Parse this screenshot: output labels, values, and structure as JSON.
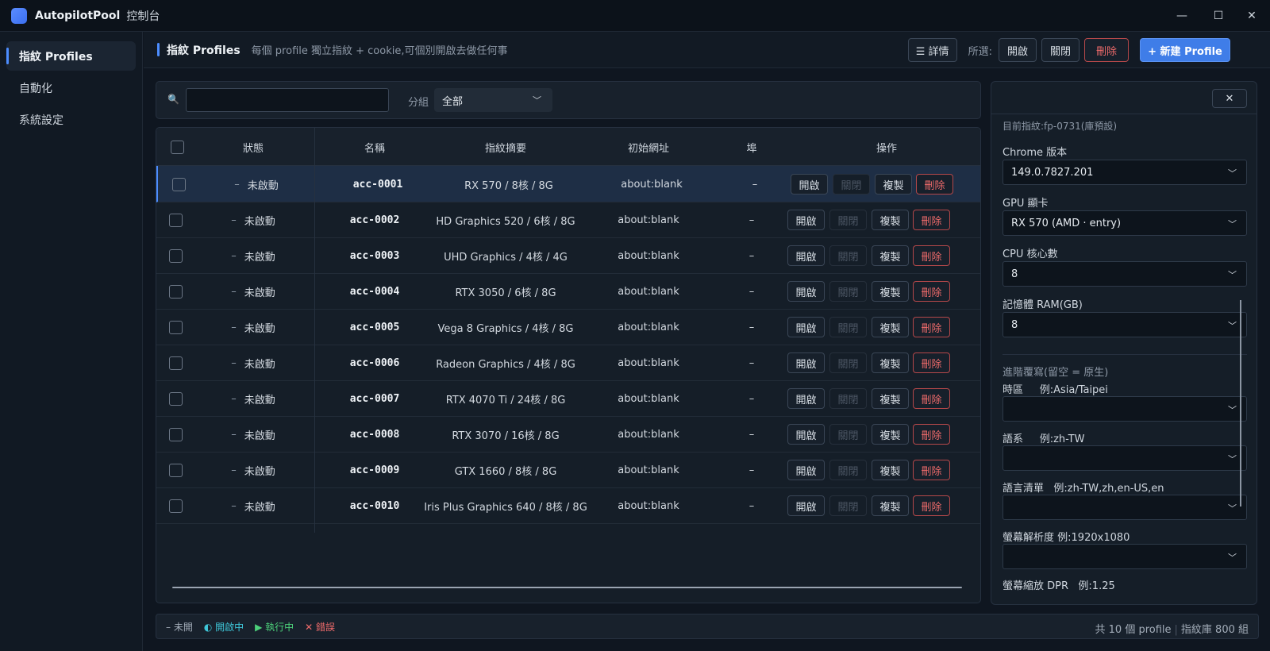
{
  "app": {
    "name": "AutopilotPool",
    "subtitle": "控制台"
  },
  "window_controls": {
    "minimize": "—",
    "maximize": "☐",
    "close": "✕"
  },
  "sidebar": {
    "items": [
      {
        "label": "指紋 Profiles",
        "active": true
      },
      {
        "label": "自動化",
        "active": false
      },
      {
        "label": "系統設定",
        "active": false
      }
    ]
  },
  "header": {
    "title": "指紋 Profiles",
    "description": "每個 profile 獨立指紋 + cookie,可個別開啟去做任何事",
    "details_button": "☰ 詳情",
    "selected_label": "所選:",
    "open_button": "開啟",
    "close_button": "關閉",
    "delete_button": "刪除",
    "new_button": "+ 新建 Profile"
  },
  "filter": {
    "search_icon": "🔍",
    "search_value": "",
    "group_label": "分組",
    "group_value": "全部"
  },
  "table": {
    "columns": [
      "狀態",
      "名稱",
      "指紋摘要",
      "初始網址",
      "埠",
      "操作"
    ],
    "actions": {
      "open": "開啟",
      "close": "關閉",
      "copy": "複製",
      "delete": "刪除"
    },
    "rows": [
      {
        "status": "未啟動",
        "name": "acc-0001",
        "summary": "RX 570 / 8核 / 8G",
        "url": "about:blank",
        "port": "–"
      },
      {
        "status": "未啟動",
        "name": "acc-0002",
        "summary": "HD Graphics 520 / 6核 / 8G",
        "url": "about:blank",
        "port": "–"
      },
      {
        "status": "未啟動",
        "name": "acc-0003",
        "summary": "UHD Graphics / 4核 / 4G",
        "url": "about:blank",
        "port": "–"
      },
      {
        "status": "未啟動",
        "name": "acc-0004",
        "summary": "RTX 3050 / 6核 / 8G",
        "url": "about:blank",
        "port": "–"
      },
      {
        "status": "未啟動",
        "name": "acc-0005",
        "summary": "Vega 8 Graphics / 4核 / 8G",
        "url": "about:blank",
        "port": "–"
      },
      {
        "status": "未啟動",
        "name": "acc-0006",
        "summary": "Radeon Graphics / 4核 / 8G",
        "url": "about:blank",
        "port": "–"
      },
      {
        "status": "未啟動",
        "name": "acc-0007",
        "summary": "RTX 4070 Ti / 24核 / 8G",
        "url": "about:blank",
        "port": "–"
      },
      {
        "status": "未啟動",
        "name": "acc-0008",
        "summary": "RTX 3070 / 16核 / 8G",
        "url": "about:blank",
        "port": "–"
      },
      {
        "status": "未啟動",
        "name": "acc-0009",
        "summary": "GTX 1660 / 8核 / 8G",
        "url": "about:blank",
        "port": "–"
      },
      {
        "status": "未啟動",
        "name": "acc-0010",
        "summary": "Iris Plus Graphics 640 / 8核 / 8G",
        "url": "about:blank",
        "port": "–"
      }
    ]
  },
  "detail": {
    "close_icon": "✕",
    "current_fp": "目前指紋:fp-0731(庫預設)",
    "chrome_label": "Chrome 版本",
    "chrome_value": "149.0.7827.201",
    "gpu_label": "GPU 顯卡",
    "gpu_value": "RX 570  (AMD · entry)",
    "cpu_label": "CPU 核心數",
    "cpu_value": "8",
    "ram_label": "記憶體 RAM(GB)",
    "ram_value": "8",
    "advanced_label": "進階覆寫(留空 = 原生)",
    "tz_label": "時區",
    "tz_hint": "例:Asia/Taipei",
    "lang_label": "語系",
    "lang_hint": "例:zh-TW",
    "langs_label": "語言清單",
    "langs_hint": "例:zh-TW,zh,en-US,en",
    "res_label": "螢幕解析度",
    "res_hint": "例:1920x1080",
    "dpr_label": "螢幕縮放 DPR",
    "dpr_hint": "例:1.25"
  },
  "footer": {
    "legend_off": "– 未開",
    "legend_on": "◐ 開啟中",
    "legend_run": "▶ 執行中",
    "legend_err": "✕ 錯誤",
    "count": "共 10 個 profile",
    "library": "指紋庫 800 組"
  },
  "colors": {
    "accent": "#4c8dff",
    "danger": "#ef6b6b",
    "primary": "#3f7de8"
  }
}
